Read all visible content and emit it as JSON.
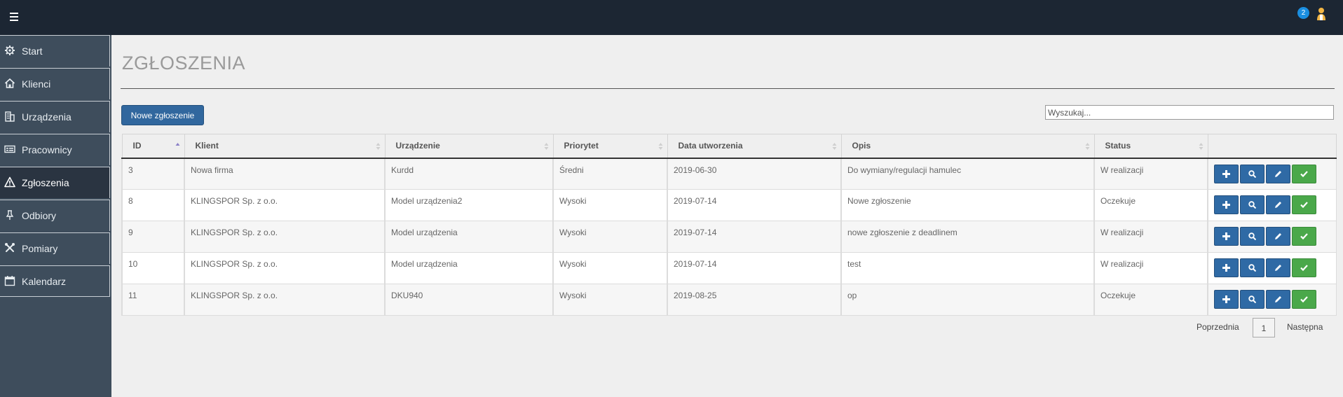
{
  "topbar": {
    "notification_count": "2"
  },
  "sidebar": {
    "items": [
      {
        "label": "Start",
        "icon": "gear-icon"
      },
      {
        "label": "Klienci",
        "icon": "home-icon"
      },
      {
        "label": "Urządzenia",
        "icon": "building-icon"
      },
      {
        "label": "Pracownicy",
        "icon": "id-card-icon"
      },
      {
        "label": "Zgłoszenia",
        "icon": "warning-icon",
        "active": true
      },
      {
        "label": "Odbiory",
        "icon": "pin-icon"
      },
      {
        "label": "Pomiary",
        "icon": "tools-icon"
      },
      {
        "label": "Kalendarz",
        "icon": "calendar-icon"
      }
    ]
  },
  "main": {
    "title": "ZGŁOSZENIA",
    "new_button": "Nowe zgłoszenie",
    "search_placeholder": "Wyszukaj..."
  },
  "table": {
    "columns": [
      "ID",
      "Klient",
      "Urządzenie",
      "Priorytet",
      "Data utworzenia",
      "Opis",
      "Status",
      ""
    ],
    "rows": [
      [
        "3",
        "Nowa firma",
        "Kurdd",
        "Średni",
        "2019-06-30",
        "Do wymiany/regulacji hamulec",
        "W realizacji"
      ],
      [
        "8",
        "KLINGSPOR Sp. z o.o.",
        "Model urządzenia2",
        "Wysoki",
        "2019-07-14",
        "Nowe zgłoszenie",
        "Oczekuje"
      ],
      [
        "9",
        "KLINGSPOR Sp. z o.o.",
        "Model urządzenia",
        "Wysoki",
        "2019-07-14",
        "nowe zgłoszenie z deadlinem",
        "W realizacji"
      ],
      [
        "10",
        "KLINGSPOR Sp. z o.o.",
        "Model urządzenia",
        "Wysoki",
        "2019-07-14",
        "test",
        "W realizacji"
      ],
      [
        "11",
        "KLINGSPOR Sp. z o.o.",
        "DKU940",
        "Wysoki",
        "2019-08-25",
        "op",
        "Oczekuje"
      ]
    ],
    "row_actions": [
      "plus-icon",
      "search-icon",
      "pencil-icon",
      "check-icon"
    ]
  },
  "pagination": {
    "prev": "Poprzednia",
    "page": "1",
    "next": "Następna"
  },
  "colors": {
    "topbar": "#1c2633",
    "sidebar": "#3e4d5c",
    "primary": "#2f6aa5",
    "success": "#4aa84a",
    "badge": "#1a8ee0"
  }
}
